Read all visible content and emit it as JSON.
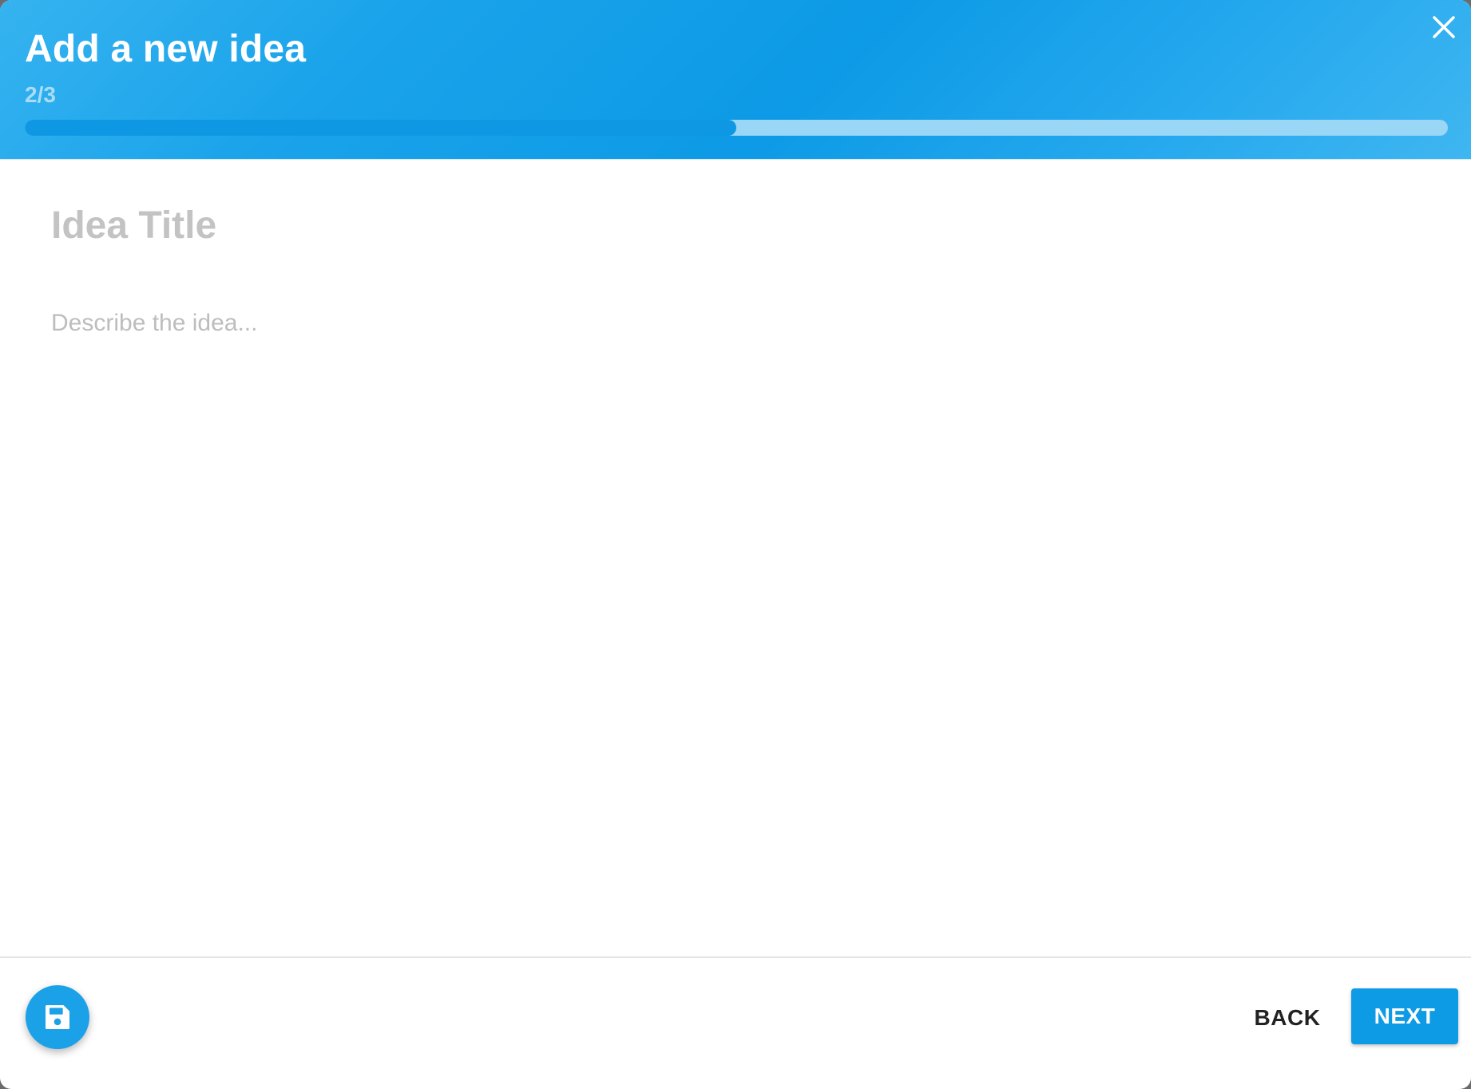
{
  "dialog": {
    "title": "Add a new idea",
    "step": "2/3",
    "progress": 0.5,
    "close_icon": "close-icon"
  },
  "form": {
    "title_placeholder": "Idea Title",
    "title_value": "",
    "description_placeholder": "Describe the idea...",
    "description_value": ""
  },
  "footer": {
    "save_icon": "floppy-disk-icon",
    "back_label": "BACK",
    "next_label": "NEXT"
  },
  "colors": {
    "accent": "#0e9be5",
    "header_gradient": [
      "#36b3f0",
      "#0d9ae6",
      "#3fb6f1"
    ],
    "progress_track": "#9ad6f6"
  }
}
